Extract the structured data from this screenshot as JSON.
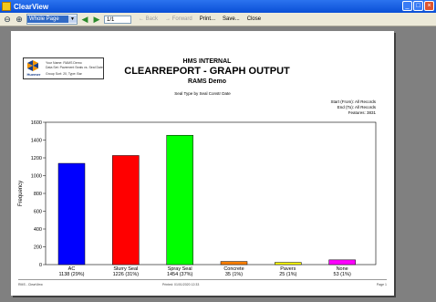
{
  "window": {
    "title": "ClearView"
  },
  "toolbar": {
    "zoom_value": "Whole Page",
    "page_value": "1/1",
    "back_label": "Back",
    "forward_label": "Forward",
    "print_label": "Print...",
    "save_label": "Save...",
    "close_label": "Close"
  },
  "report": {
    "logo_text": "Huemer",
    "header_line1": "Your Name: RAMS Demo",
    "header_line2": "Data Set: Pavement Seals vs. Seal Date",
    "header_line3": "Group Sort: 20, Type: Bar",
    "org": "HMS INTERNAL",
    "title": "CLEARREPORT - GRAPH OUTPUT",
    "subtitle": "RAMS Demo",
    "chart_title": "Seal Type by Seal Constr Date",
    "filter_start": "Start (From): All Records",
    "filter_end": "End (To): All Records",
    "filter_features": "Features: 3831",
    "footer_left": "RMS - ClearView",
    "footer_mid": "Printed: 01/01/2020 12:33",
    "footer_right": "Page 1"
  },
  "chart_data": {
    "type": "bar",
    "title": "Seal Type by Seal Constr Date",
    "ylabel": "Frequency",
    "xlabel": "",
    "ylim": [
      0,
      1600
    ],
    "yticks": [
      0,
      200,
      400,
      600,
      800,
      1000,
      1200,
      1400,
      1600
    ],
    "categories": [
      "AC",
      "Slurry Seal",
      "Spray Seal",
      "Concrete",
      "Pavers",
      "None"
    ],
    "value_labels": [
      "1138 (29%)",
      "1226 (31%)",
      "1454 (37%)",
      "35 (1%)",
      "25 (1%)",
      "53 (1%)"
    ],
    "values": [
      1138,
      1226,
      1454,
      35,
      25,
      53
    ],
    "colors": [
      "#0000ff",
      "#ff0000",
      "#00ff00",
      "#ff8000",
      "#ffff00",
      "#ff00ff"
    ],
    "grid": false
  }
}
